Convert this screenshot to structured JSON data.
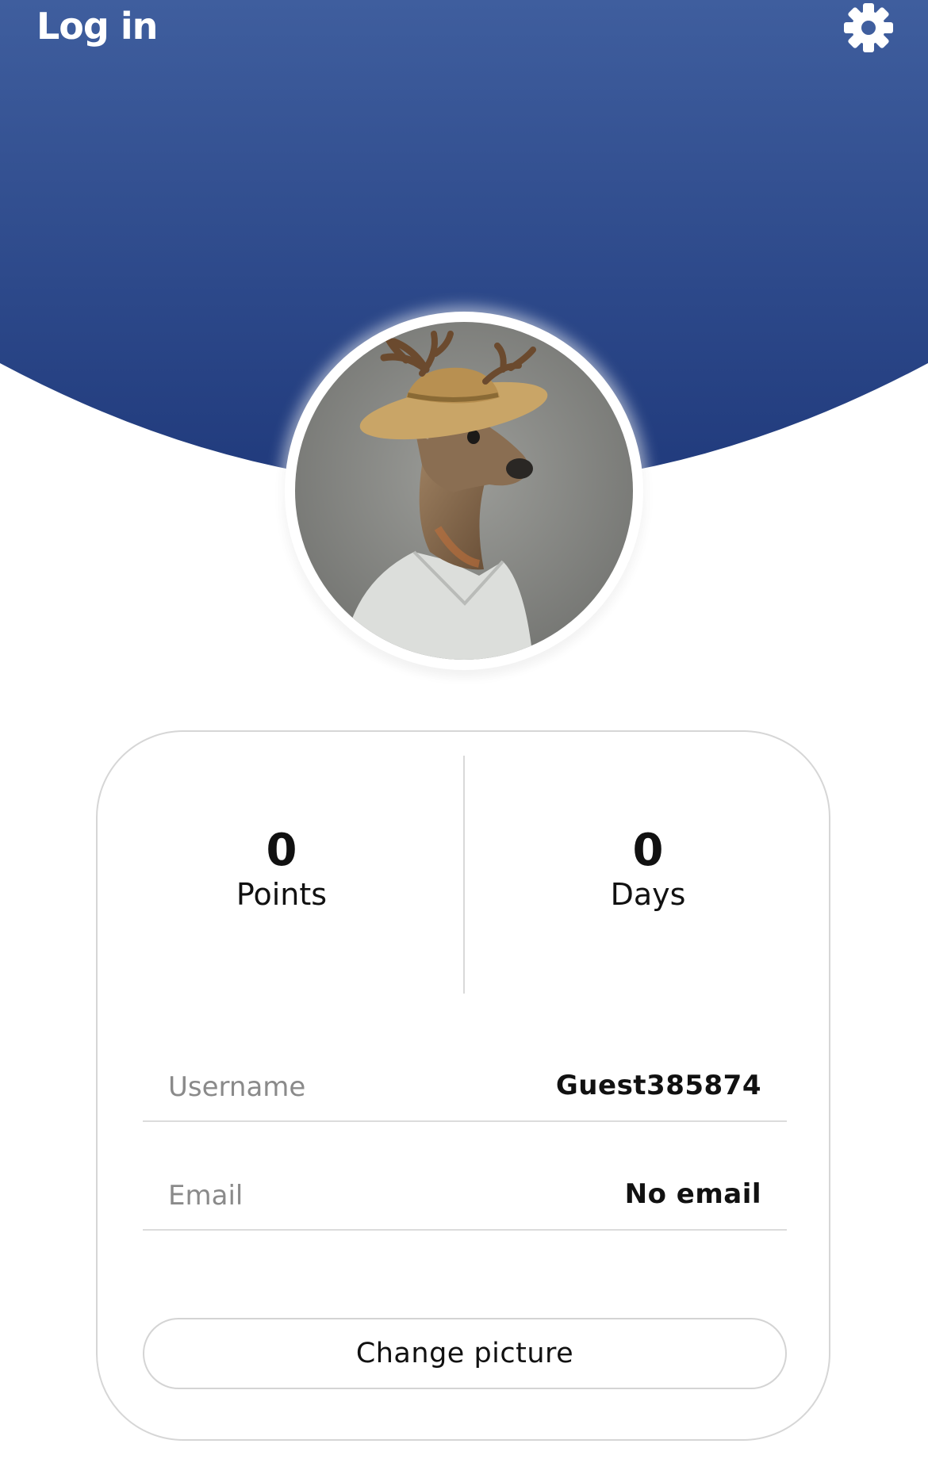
{
  "header": {
    "login_label": "Log in",
    "settings_icon": "gear-icon",
    "gradient_top": "#3f5e9e",
    "gradient_bottom": "#203a7c"
  },
  "profile": {
    "avatar_description": "deer-portrait"
  },
  "stats": {
    "points_value": "0",
    "points_label": "Points",
    "days_value": "0",
    "days_label": "Days"
  },
  "details": {
    "username_label": "Username",
    "username_value": "Guest385874",
    "email_label": "Email",
    "email_value": "No email"
  },
  "actions": {
    "change_picture_label": "Change picture"
  }
}
